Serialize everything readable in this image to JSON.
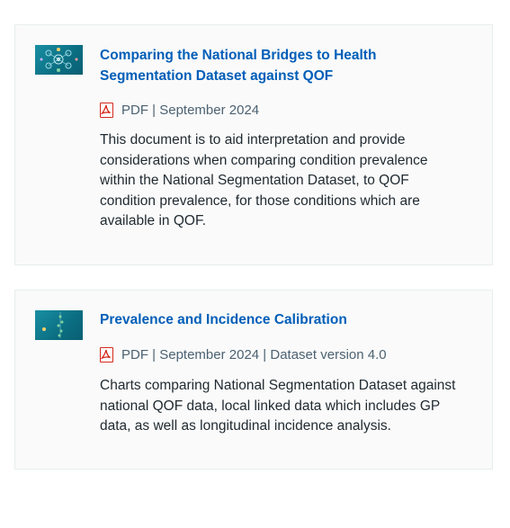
{
  "documents": [
    {
      "title": "Comparing the National Bridges to Health Segmentation Dataset against QOF",
      "file_type": "PDF",
      "meta": "PDF | September 2024",
      "description": "This document is to aid interpretation and provide considerations when comparing condition prevalence within the National Segmentation Dataset, to QOF condition prevalence, for those conditions which are available in QOF.",
      "thumbnail_icon": "network-diagram-thumbnail",
      "file_icon": "pdf-icon"
    },
    {
      "title": "Prevalence and Incidence Calibration",
      "file_type": "PDF",
      "meta": "PDF | September 2024 | Dataset version 4.0",
      "description": "Charts comparing National Segmentation Dataset against national QOF data, local linked data which includes GP data, as well as longitudinal incidence analysis.",
      "thumbnail_icon": "dots-chart-thumbnail",
      "file_icon": "pdf-icon"
    }
  ],
  "colors": {
    "link": "#005eb8",
    "pdf_red": "#d5281b",
    "thumbnail_teal": "#0b6e82"
  }
}
